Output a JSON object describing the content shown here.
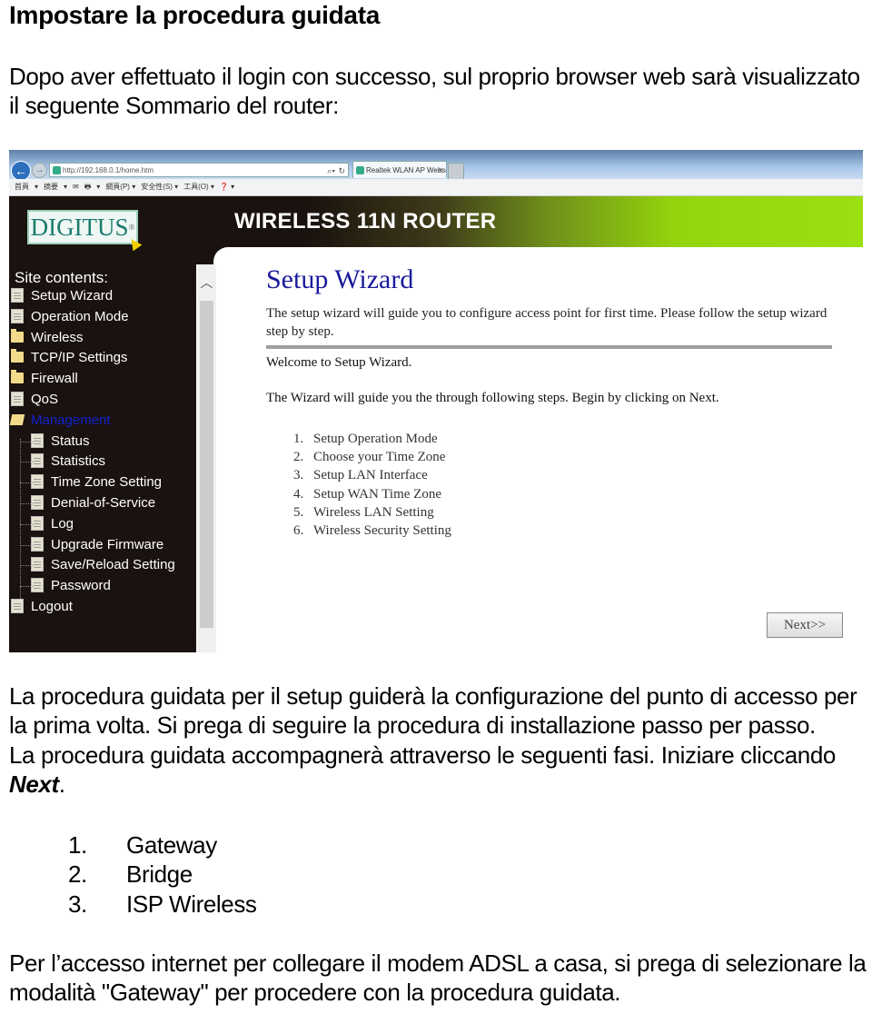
{
  "document": {
    "title": "Impostare la procedura guidata",
    "intro": "Dopo aver effettuato il login con successo, sul proprio browser web sarà visualizzato il seguente Sommario del router:",
    "body_line1": "La procedura guidata per il setup guiderà la configurazione del punto di accesso per la prima volta. Si prega di seguire la procedura di installazione passo per passo.",
    "body_line2_prefix": "La procedura guidata accompagnerà attraverso le seguenti fasi. Iniziare cliccando ",
    "body_line2_emph": "Next",
    "body_line2_suffix": ".",
    "modes": [
      {
        "num": "1.",
        "label": "Gateway"
      },
      {
        "num": "2.",
        "label": "Bridge"
      },
      {
        "num": "3.",
        "label": "ISP Wireless"
      }
    ],
    "closing": "Per l’accesso internet per collegare il modem ADSL a casa, si prega di selezionare la modalità \"Gateway\" per procedere con la procedura guidata."
  },
  "browser": {
    "address": "http://192.168.0.1/home.htm",
    "tab_title": "Realtek WLAN AP Webse...",
    "command_bar": [
      "首頁",
      "▾",
      "摘要",
      "▾",
      "✉",
      "🖶",
      "▾",
      "網頁(P) ▾",
      "安全性(S) ▾",
      "工具(O) ▾",
      "❓ ▾"
    ]
  },
  "router": {
    "logo": "DIGITUS",
    "logo_mark": "®",
    "title": "WIRELESS 11N ROUTER",
    "sidebar_heading": "Site contents:",
    "menu": [
      {
        "label": "Setup Wizard",
        "icon": "doc"
      },
      {
        "label": "Operation Mode",
        "icon": "doc"
      },
      {
        "label": "Wireless",
        "icon": "folder"
      },
      {
        "label": "TCP/IP Settings",
        "icon": "folder"
      },
      {
        "label": "Firewall",
        "icon": "folder"
      },
      {
        "label": "QoS",
        "icon": "doc"
      },
      {
        "label": "Management",
        "icon": "folder-open",
        "active": true
      },
      {
        "label": "Status",
        "icon": "doc"
      },
      {
        "label": "Statistics",
        "icon": "doc"
      },
      {
        "label": "Time Zone Setting",
        "icon": "doc"
      },
      {
        "label": "Denial-of-Service",
        "icon": "doc"
      },
      {
        "label": "Log",
        "icon": "doc"
      },
      {
        "label": "Upgrade Firmware",
        "icon": "doc"
      },
      {
        "label": "Save/Reload Setting",
        "icon": "doc"
      },
      {
        "label": "Password",
        "icon": "doc"
      },
      {
        "label": "Logout",
        "icon": "doc"
      }
    ],
    "wizard": {
      "title": "Setup Wizard",
      "description": "The setup wizard will guide you to configure access point for first time. Please follow the setup wizard step by step.",
      "welcome": "Welcome to Setup Wizard.",
      "guide": "The Wizard will guide you the through following steps. Begin by clicking on Next.",
      "steps": [
        {
          "num": "1.",
          "label": "Setup Operation Mode"
        },
        {
          "num": "2.",
          "label": "Choose your Time Zone"
        },
        {
          "num": "3.",
          "label": "Setup LAN Interface"
        },
        {
          "num": "4.",
          "label": "Setup WAN Time Zone"
        },
        {
          "num": "5.",
          "label": "Wireless LAN Setting"
        },
        {
          "num": "6.",
          "label": "Wireless Security Setting"
        }
      ],
      "next_label": "Next>>"
    }
  },
  "colors": {
    "wizard_title": "#1a1a9c",
    "active_menu": "#1122cc",
    "sidebar_bg": "#1a1210",
    "header_green": "#94d40d"
  }
}
